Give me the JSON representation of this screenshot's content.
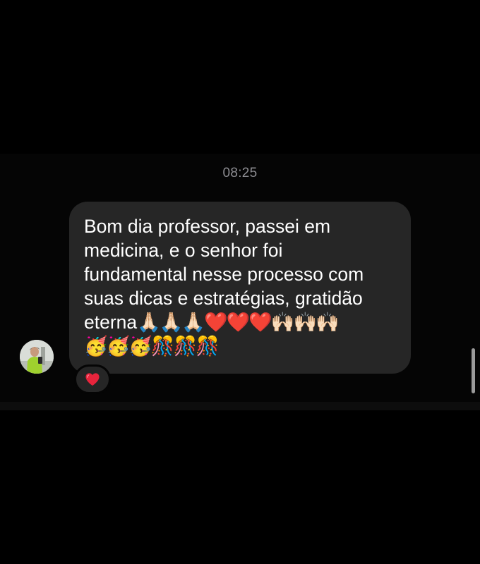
{
  "conversation": {
    "timestamp": "08:25",
    "message": {
      "lines": [
        "Bom dia professor, passei em",
        "medicina, e o senhor foi",
        "fundamental nesse processo com",
        "suas dicas e estratégias, gratidão"
      ],
      "last_line_text": "eterna",
      "emoji_line_1": "🙏🏻🙏🏻🙏🏻❤️❤️❤️🙌🏻🙌🏻🙌🏻",
      "emoji_line_2": "🥳🥳🥳🎊🎊🎊"
    },
    "reaction": {
      "emoji": "red-heart",
      "icon": "heart-icon"
    }
  },
  "colors": {
    "background": "#000000",
    "bubble": "#262626",
    "timestamp": "#8e8e93",
    "heart": "#e8243c"
  }
}
